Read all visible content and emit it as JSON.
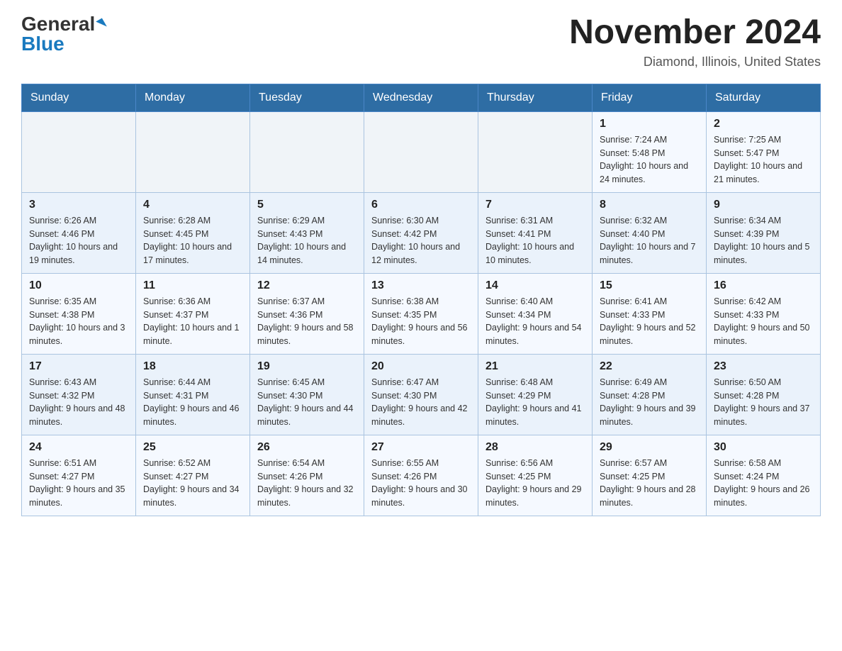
{
  "header": {
    "logo_general": "General",
    "logo_blue": "Blue",
    "month_title": "November 2024",
    "location": "Diamond, Illinois, United States"
  },
  "weekdays": [
    "Sunday",
    "Monday",
    "Tuesday",
    "Wednesday",
    "Thursday",
    "Friday",
    "Saturday"
  ],
  "weeks": [
    [
      {
        "day": "",
        "info": ""
      },
      {
        "day": "",
        "info": ""
      },
      {
        "day": "",
        "info": ""
      },
      {
        "day": "",
        "info": ""
      },
      {
        "day": "",
        "info": ""
      },
      {
        "day": "1",
        "info": "Sunrise: 7:24 AM\nSunset: 5:48 PM\nDaylight: 10 hours and 24 minutes."
      },
      {
        "day": "2",
        "info": "Sunrise: 7:25 AM\nSunset: 5:47 PM\nDaylight: 10 hours and 21 minutes."
      }
    ],
    [
      {
        "day": "3",
        "info": "Sunrise: 6:26 AM\nSunset: 4:46 PM\nDaylight: 10 hours and 19 minutes."
      },
      {
        "day": "4",
        "info": "Sunrise: 6:28 AM\nSunset: 4:45 PM\nDaylight: 10 hours and 17 minutes."
      },
      {
        "day": "5",
        "info": "Sunrise: 6:29 AM\nSunset: 4:43 PM\nDaylight: 10 hours and 14 minutes."
      },
      {
        "day": "6",
        "info": "Sunrise: 6:30 AM\nSunset: 4:42 PM\nDaylight: 10 hours and 12 minutes."
      },
      {
        "day": "7",
        "info": "Sunrise: 6:31 AM\nSunset: 4:41 PM\nDaylight: 10 hours and 10 minutes."
      },
      {
        "day": "8",
        "info": "Sunrise: 6:32 AM\nSunset: 4:40 PM\nDaylight: 10 hours and 7 minutes."
      },
      {
        "day": "9",
        "info": "Sunrise: 6:34 AM\nSunset: 4:39 PM\nDaylight: 10 hours and 5 minutes."
      }
    ],
    [
      {
        "day": "10",
        "info": "Sunrise: 6:35 AM\nSunset: 4:38 PM\nDaylight: 10 hours and 3 minutes."
      },
      {
        "day": "11",
        "info": "Sunrise: 6:36 AM\nSunset: 4:37 PM\nDaylight: 10 hours and 1 minute."
      },
      {
        "day": "12",
        "info": "Sunrise: 6:37 AM\nSunset: 4:36 PM\nDaylight: 9 hours and 58 minutes."
      },
      {
        "day": "13",
        "info": "Sunrise: 6:38 AM\nSunset: 4:35 PM\nDaylight: 9 hours and 56 minutes."
      },
      {
        "day": "14",
        "info": "Sunrise: 6:40 AM\nSunset: 4:34 PM\nDaylight: 9 hours and 54 minutes."
      },
      {
        "day": "15",
        "info": "Sunrise: 6:41 AM\nSunset: 4:33 PM\nDaylight: 9 hours and 52 minutes."
      },
      {
        "day": "16",
        "info": "Sunrise: 6:42 AM\nSunset: 4:33 PM\nDaylight: 9 hours and 50 minutes."
      }
    ],
    [
      {
        "day": "17",
        "info": "Sunrise: 6:43 AM\nSunset: 4:32 PM\nDaylight: 9 hours and 48 minutes."
      },
      {
        "day": "18",
        "info": "Sunrise: 6:44 AM\nSunset: 4:31 PM\nDaylight: 9 hours and 46 minutes."
      },
      {
        "day": "19",
        "info": "Sunrise: 6:45 AM\nSunset: 4:30 PM\nDaylight: 9 hours and 44 minutes."
      },
      {
        "day": "20",
        "info": "Sunrise: 6:47 AM\nSunset: 4:30 PM\nDaylight: 9 hours and 42 minutes."
      },
      {
        "day": "21",
        "info": "Sunrise: 6:48 AM\nSunset: 4:29 PM\nDaylight: 9 hours and 41 minutes."
      },
      {
        "day": "22",
        "info": "Sunrise: 6:49 AM\nSunset: 4:28 PM\nDaylight: 9 hours and 39 minutes."
      },
      {
        "day": "23",
        "info": "Sunrise: 6:50 AM\nSunset: 4:28 PM\nDaylight: 9 hours and 37 minutes."
      }
    ],
    [
      {
        "day": "24",
        "info": "Sunrise: 6:51 AM\nSunset: 4:27 PM\nDaylight: 9 hours and 35 minutes."
      },
      {
        "day": "25",
        "info": "Sunrise: 6:52 AM\nSunset: 4:27 PM\nDaylight: 9 hours and 34 minutes."
      },
      {
        "day": "26",
        "info": "Sunrise: 6:54 AM\nSunset: 4:26 PM\nDaylight: 9 hours and 32 minutes."
      },
      {
        "day": "27",
        "info": "Sunrise: 6:55 AM\nSunset: 4:26 PM\nDaylight: 9 hours and 30 minutes."
      },
      {
        "day": "28",
        "info": "Sunrise: 6:56 AM\nSunset: 4:25 PM\nDaylight: 9 hours and 29 minutes."
      },
      {
        "day": "29",
        "info": "Sunrise: 6:57 AM\nSunset: 4:25 PM\nDaylight: 9 hours and 28 minutes."
      },
      {
        "day": "30",
        "info": "Sunrise: 6:58 AM\nSunset: 4:24 PM\nDaylight: 9 hours and 26 minutes."
      }
    ]
  ]
}
